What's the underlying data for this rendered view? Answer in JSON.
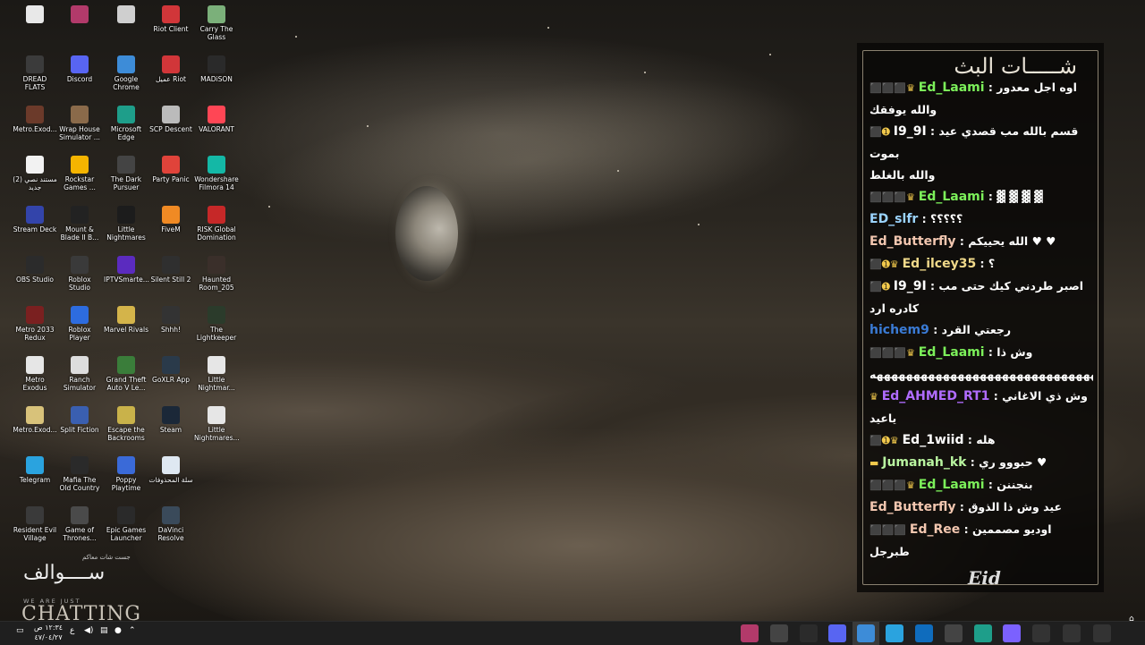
{
  "desktop_icons": [
    {
      "label": "",
      "color": "#e8e8e8",
      "glyph": "doc-icon"
    },
    {
      "label": "",
      "color": "#b23a6a",
      "glyph": "winrar-icon"
    },
    {
      "label": "",
      "color": "#cfcfcf",
      "glyph": "shortcut-icon"
    },
    {
      "label": "Riot Client",
      "color": "#d13639",
      "glyph": "riot-icon"
    },
    {
      "label": "Carry The Glass",
      "color": "#7bb07a",
      "glyph": "game-icon"
    },
    {
      "label": "DREAD FLATS",
      "color": "#3b3b3b",
      "glyph": "game-icon"
    },
    {
      "label": "Discord",
      "color": "#5865f2",
      "glyph": "discord-icon"
    },
    {
      "label": "Google Chrome",
      "color": "#3d8cd8",
      "glyph": "chrome-icon"
    },
    {
      "label": "عميل Riot",
      "color": "#d13639",
      "glyph": "riot-icon"
    },
    {
      "label": "MADiSON",
      "color": "#2a2a2a",
      "glyph": "game-icon"
    },
    {
      "label": "Metro.Exod...",
      "color": "#6b3a2a",
      "glyph": "winrar-icon"
    },
    {
      "label": "Wrap House Simulator ...",
      "color": "#8a6a4a",
      "glyph": "game-icon"
    },
    {
      "label": "Microsoft Edge",
      "color": "#1e9e8a",
      "glyph": "edge-icon"
    },
    {
      "label": "SCP Descent",
      "color": "#bbbbbb",
      "glyph": "game-icon"
    },
    {
      "label": "VALORANT",
      "color": "#ff4655",
      "glyph": "valorant-icon"
    },
    {
      "label": "مستند نصي (2) جديد",
      "color": "#f2f2f2",
      "glyph": "doc-icon"
    },
    {
      "label": "Rockstar Games ...",
      "color": "#f5b400",
      "glyph": "rockstar-icon"
    },
    {
      "label": "The Dark Pursuer",
      "color": "#444444",
      "glyph": "game-icon"
    },
    {
      "label": "Party Panic",
      "color": "#e0433a",
      "glyph": "game-icon"
    },
    {
      "label": "Wondershare Filmora 14",
      "color": "#14b8a6",
      "glyph": "filmora-icon"
    },
    {
      "label": "Stream Deck",
      "color": "#3344aa",
      "glyph": "streamdeck-icon"
    },
    {
      "label": "Mount & Blade II B...",
      "color": "#222222",
      "glyph": "game-icon"
    },
    {
      "label": "Little Nightmares",
      "color": "#1c1c1c",
      "glyph": "game-icon"
    },
    {
      "label": "FiveM",
      "color": "#f08a24",
      "glyph": "fivem-icon"
    },
    {
      "label": "RISK Global Domination",
      "color": "#c62828",
      "glyph": "game-icon"
    },
    {
      "label": "OBS Studio",
      "color": "#2b2b2b",
      "glyph": "obs-icon"
    },
    {
      "label": "Roblox Studio",
      "color": "#3a3a3a",
      "glyph": "roblox-icon"
    },
    {
      "label": "IPTVSmarte...",
      "color": "#5b2bbf",
      "glyph": "iptv-icon"
    },
    {
      "label": "Silent Still 2",
      "color": "#2f2f2f",
      "glyph": "game-icon"
    },
    {
      "label": "Haunted Room_205",
      "color": "#3a2f2a",
      "glyph": "game-icon"
    },
    {
      "label": "Metro 2033 Redux",
      "color": "#7a2020",
      "glyph": "game-icon"
    },
    {
      "label": "Roblox Player",
      "color": "#2d6cdf",
      "glyph": "roblox-icon"
    },
    {
      "label": "Marvel Rivals",
      "color": "#d4b44a",
      "glyph": "game-icon"
    },
    {
      "label": "Shhh!",
      "color": "#333333",
      "glyph": "game-icon"
    },
    {
      "label": "The Lightkeeper",
      "color": "#2b3b2b",
      "glyph": "game-icon"
    },
    {
      "label": "Metro Exodus",
      "color": "#e6e6e6",
      "glyph": "game-icon"
    },
    {
      "label": "Ranch Simulator",
      "color": "#dddddd",
      "glyph": "game-icon"
    },
    {
      "label": "Grand Theft Auto V Le...",
      "color": "#3a7d3a",
      "glyph": "gta-icon"
    },
    {
      "label": "GoXLR App",
      "color": "#2a3a4a",
      "glyph": "goxlr-icon"
    },
    {
      "label": "Little Nightmar...",
      "color": "#e6e6e6",
      "glyph": "game-icon"
    },
    {
      "label": "Metro.Exod...",
      "color": "#d8c27a",
      "glyph": "doc-icon"
    },
    {
      "label": "Split Fiction",
      "color": "#3a5fb0",
      "glyph": "game-icon"
    },
    {
      "label": "Escape the Backrooms",
      "color": "#c9b24a",
      "glyph": "game-icon"
    },
    {
      "label": "Steam",
      "color": "#1b2838",
      "glyph": "steam-icon"
    },
    {
      "label": "Little Nightmares...",
      "color": "#e6e6e6",
      "glyph": "game-icon"
    },
    {
      "label": "Telegram",
      "color": "#2aa3df",
      "glyph": "telegram-icon"
    },
    {
      "label": "Mafia The Old Country",
      "color": "#2a2a2a",
      "glyph": "game-icon"
    },
    {
      "label": "Poppy Playtime",
      "color": "#3a6ad8",
      "glyph": "game-icon"
    },
    {
      "label": "سلة المحذوفات",
      "color": "#dfe8f2",
      "glyph": "recycle-bin-icon"
    },
    {
      "label": "Resident Evil Village",
      "color": "#3a3a3a",
      "glyph": "game-icon"
    },
    {
      "label": "Game of Thrones...",
      "color": "#4a4a4a",
      "glyph": "game-icon"
    },
    {
      "label": "Epic Games Launcher",
      "color": "#2a2a2a",
      "glyph": "epic-icon"
    },
    {
      "label": "DaVinci Resolve",
      "color": "#3a4a5a",
      "glyph": "davinci-icon"
    }
  ],
  "chat": {
    "title": "شـــــات البث",
    "logo": "Eid",
    "messages": [
      {
        "badges": "⬛⬛⬛♛",
        "user": "Ed_Laami",
        "user_color": "#7cf05a",
        "text": "اوه اجل معدور",
        "cont": "والله يوفقك"
      },
      {
        "badges": "⬛➊",
        "user": "I9_9I",
        "user_color": "#ffffff",
        "text": "قسم بالله مب قصدي عيد بموت",
        "cont": "والله بالغلط"
      },
      {
        "badges": "⬛⬛⬛♛",
        "user": "Ed_Laami",
        "user_color": "#7cf05a",
        "text": "▓ ▓ ▓ ▓",
        "cont": ""
      },
      {
        "badges": "",
        "user": "ED_slfr",
        "user_color": "#9bd4ff",
        "text": "؟؟؟؟؟",
        "cont": ""
      },
      {
        "badges": "",
        "user": "Ed_Butterfly",
        "user_color": "#f3c7b0",
        "text": "الله يحييكم ♥ ♥",
        "cont": ""
      },
      {
        "badges": "⬛➊♛",
        "user": "Ed_ilcey35",
        "user_color": "#f0d98a",
        "text": "؟",
        "cont": ""
      },
      {
        "badges": "⬛➊",
        "user": "I9_9I",
        "user_color": "#ffffff",
        "text": "اصبر طردني كيك حتى مب",
        "cont": "كادره ارد"
      },
      {
        "badges": "",
        "user": "hichem9",
        "user_color": "#3a7bd5",
        "text": "رجعتي القرد",
        "cont": ""
      },
      {
        "badges": "⬛⬛⬛♛",
        "user": "Ed_Laami",
        "user_color": "#7cf05a",
        "text": "وش ذا",
        "cont": "هههههههههههههههههههههههههههههههه"
      },
      {
        "badges": "♛",
        "user": "Ed_AHMED_RT1",
        "user_color": "#b06cff",
        "text": "وش ذي الاغاني",
        "cont": "ياعيد"
      },
      {
        "badges": "⬛➊♛",
        "user": "Ed_1wiid",
        "user_color": "#ffffff",
        "text": "هله",
        "cont": ""
      },
      {
        "badges": "▬",
        "user": "Jumanah_kk",
        "user_color": "#b9f5a0",
        "text": "حبووو ري ♥",
        "cont": ""
      },
      {
        "badges": "⬛⬛⬛♛",
        "user": "Ed_Laami",
        "user_color": "#7cf05a",
        "text": "بنجننن",
        "cont": ""
      },
      {
        "badges": "",
        "user": "Ed_Butterfly",
        "user_color": "#f3c7b0",
        "text": "عيد وش ذا الذوق",
        "cont": ""
      },
      {
        "badges": "⬛⬛⬛",
        "user": "Ed_Ree",
        "user_color": "#f3c7b0",
        "text": "اوديو مصممين طبرجل",
        "cont": ""
      }
    ]
  },
  "bottom_left": {
    "arabic_logo": "ســــوالف",
    "subtitle": "جست شات معاكم",
    "tagline": "WE ARE JUST",
    "big": "CHATTING"
  },
  "taskbar": {
    "time": "١٢:٣٤ ص",
    "date": "٤٧/٠٤/٢٧",
    "lang": "ع",
    "apps": [
      "winrar-icon",
      "xbox-icon",
      "obs-icon",
      "discord-icon",
      "chrome-icon",
      "telegram-icon",
      "outlook-icon",
      "store-icon",
      "edge-icon",
      "copilot-icon",
      "taskview-icon",
      "search-icon",
      "start-icon"
    ]
  }
}
